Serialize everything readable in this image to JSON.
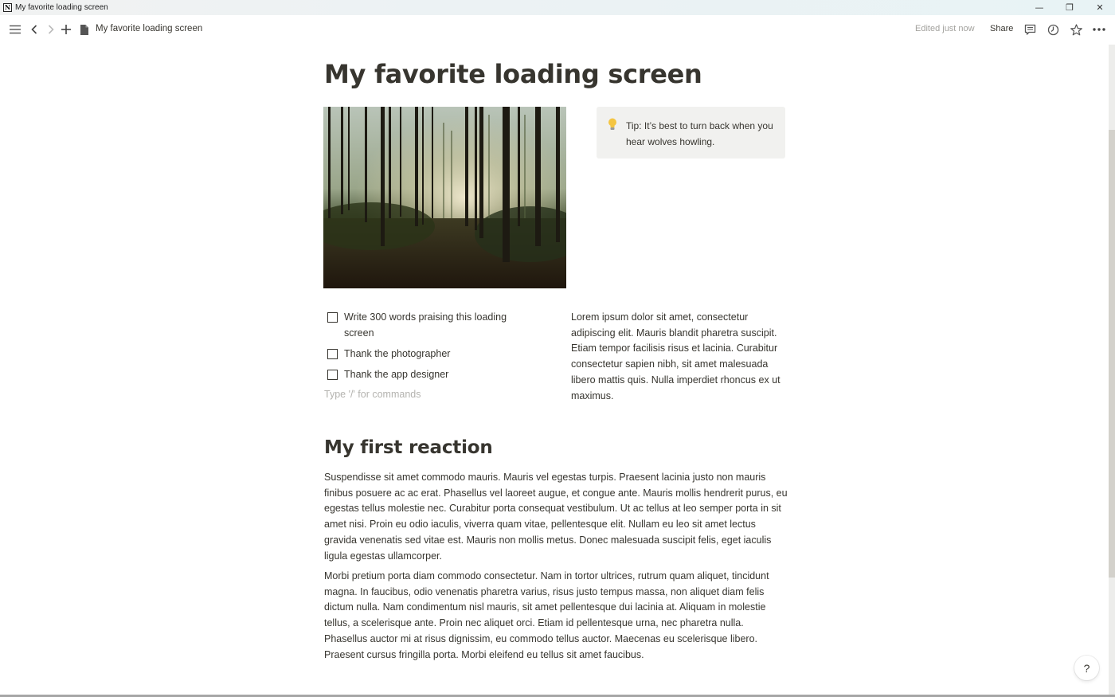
{
  "window": {
    "title": "My favorite loading screen",
    "controls": {
      "minimize": "—",
      "restore": "❐",
      "close": "✕"
    }
  },
  "topbar": {
    "icons": [
      "menu-icon",
      "back-icon",
      "forward-icon",
      "add-icon",
      "page-icon"
    ],
    "breadcrumb": "My favorite loading screen",
    "edited_status": "Edited just now",
    "share_label": "Share",
    "right_icons": [
      "comment-icon",
      "history-icon",
      "favorite-star-icon",
      "more-icon"
    ]
  },
  "page": {
    "title": "My favorite loading screen",
    "cover_image_alt": "Misty pine forest with sunlight rays",
    "callout": {
      "icon": "lightbulb-icon",
      "text": "Tip: It’s best to turn back when you hear wolves howling."
    },
    "todos": [
      {
        "label": "Write 300 words praising this loading screen",
        "checked": false
      },
      {
        "label": "Thank the photographer",
        "checked": false
      },
      {
        "label": "Thank the app designer",
        "checked": false
      }
    ],
    "command_placeholder": "Type '/' for commands",
    "side_paragraph": "Lorem ipsum dolor sit amet, consectetur adipiscing elit. Mauris blandit pharetra suscipit. Etiam tempor facilisis risus et lacinia. Curabitur consectetur sapien nibh, sit amet malesuada libero mattis quis. Nulla imperdiet rhoncus ex ut maximus.",
    "section_heading": "My first reaction",
    "paragraphs": [
      "Suspendisse sit amet commodo mauris. Mauris vel egestas turpis. Praesent lacinia justo non mauris finibus posuere ac ac erat. Phasellus vel laoreet augue, et congue ante. Mauris mollis hendrerit purus, eu egestas tellus molestie nec. Curabitur porta consequat vestibulum. Ut ac tellus at leo semper porta in sit amet nisi. Proin eu odio iaculis, viverra quam vitae, pellentesque elit. Nullam eu leo sit amet lectus gravida venenatis sed vitae est. Mauris non mollis metus. Donec malesuada suscipit felis, eget iaculis ligula egestas ullamcorper.",
      "Morbi pretium porta diam commodo consectetur. Nam in tortor ultrices, rutrum quam aliquet, tincidunt magna. In faucibus, odio venenatis pharetra varius, risus justo tempus massa, non aliquet diam felis dictum nulla. Nam condimentum nisl mauris, sit amet pellentesque dui lacinia at. Aliquam in molestie tellus, a scelerisque ante. Proin nec aliquet orci. Etiam id pellentesque urna, nec pharetra nulla. Phasellus auctor mi at risus dignissim, eu commodo tellus auctor. Maecenas eu scelerisque libero. Praesent cursus fringilla porta. Morbi eleifend eu tellus sit amet faucibus."
    ]
  },
  "help_button": {
    "label": "?"
  },
  "colors": {
    "text": "#37352f",
    "muted": "#a3a29e",
    "callout_bg": "#f1f1ef",
    "bulb": "#f4c542"
  }
}
